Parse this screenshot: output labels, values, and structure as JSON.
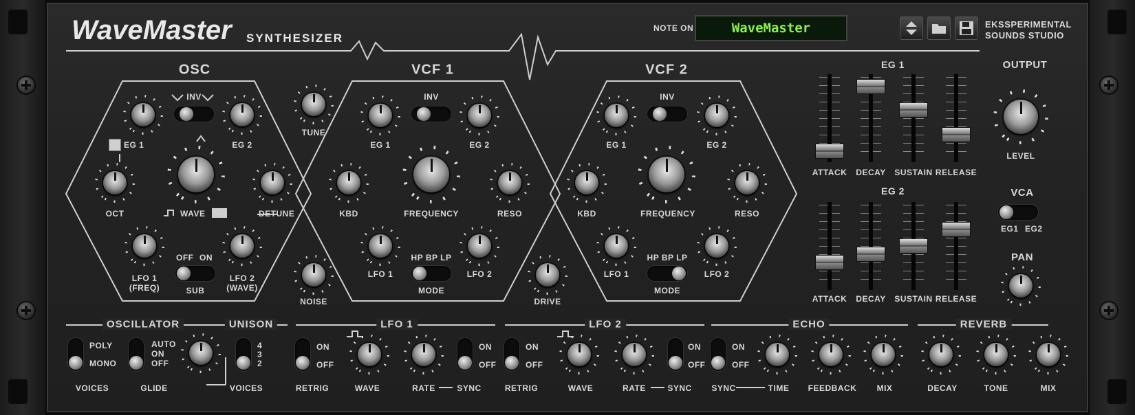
{
  "brand": {
    "name": "WaveMaster",
    "subtitle": "SYNTHESIZER",
    "studio_line1": "EKSSPERIMENTAL",
    "studio_line2": "SOUNDS STUDIO"
  },
  "header": {
    "note_on_label": "NOTE ON",
    "patch_display": "WaveMaster",
    "icons": [
      "arrow-up-icon",
      "arrow-down-icon",
      "folder-icon",
      "save-icon"
    ]
  },
  "osc": {
    "title": "OSC",
    "inv": "INV",
    "eg1": "EG 1",
    "eg2": "EG 2",
    "oct": "OCT",
    "wave": "WAVE",
    "detune": "DETUNE",
    "lfo1": "LFO 1",
    "lfo1_sub": "(FREQ)",
    "lfo2": "LFO 2",
    "lfo2_sub": "(WAVE)",
    "sub": "SUB",
    "off": "OFF",
    "on": "ON"
  },
  "tune": "TUNE",
  "noise": "NOISE",
  "drive": "DRIVE",
  "vcf1": {
    "title": "VCF 1",
    "inv": "INV",
    "eg1": "EG 1",
    "eg2": "EG 2",
    "kbd": "KBD",
    "frequency": "FREQUENCY",
    "reso": "RESO",
    "lfo1": "LFO 1",
    "lfo2": "LFO 2",
    "mode_opts": "HP BP LP",
    "mode": "MODE"
  },
  "vcf2": {
    "title": "VCF 2",
    "inv": "INV",
    "eg1": "EG 1",
    "eg2": "EG 2",
    "kbd": "KBD",
    "frequency": "FREQUENCY",
    "reso": "RESO",
    "lfo1": "LFO 1",
    "lfo2": "LFO 2",
    "mode_opts": "HP BP LP",
    "mode": "MODE"
  },
  "eg1": {
    "title": "EG 1",
    "labels": [
      "ATTACK",
      "DECAY",
      "SUSTAIN",
      "RELEASE"
    ],
    "levels": [
      0.1,
      0.88,
      0.6,
      0.3
    ]
  },
  "eg2": {
    "title": "EG 2",
    "labels": [
      "ATTACK",
      "DECAY",
      "SUSTAIN",
      "RELEASE"
    ],
    "levels": [
      0.3,
      0.4,
      0.5,
      0.7
    ]
  },
  "output": {
    "title": "OUTPUT",
    "level": "LEVEL",
    "vca": "VCA",
    "eg1": "EG1",
    "eg2": "EG2",
    "pan": "PAN"
  },
  "oscillator": {
    "title": "OSCILLATOR",
    "poly": "POLY",
    "mono": "MONO",
    "voices": "VOICES",
    "auto": "AUTO",
    "on": "ON",
    "off": "OFF",
    "glide": "GLIDE"
  },
  "unison": {
    "title": "UNISON",
    "n4": "4",
    "n3": "3",
    "n2": "2",
    "voices": "VOICES"
  },
  "lfo1": {
    "title": "LFO 1",
    "on": "ON",
    "off": "OFF",
    "retrig": "RETRIG",
    "wave": "WAVE",
    "rate": "RATE",
    "sync": "SYNC"
  },
  "lfo2": {
    "title": "LFO 2",
    "on": "ON",
    "off": "OFF",
    "retrig": "RETRIG",
    "wave": "WAVE",
    "rate": "RATE",
    "sync": "SYNC"
  },
  "echo": {
    "title": "ECHO",
    "on": "ON",
    "off": "OFF",
    "sync": "SYNC",
    "time": "TIME",
    "feedback": "FEEDBACK",
    "mix": "MIX"
  },
  "reverb": {
    "title": "REVERB",
    "decay": "DECAY",
    "tone": "TONE",
    "mix": "MIX"
  }
}
